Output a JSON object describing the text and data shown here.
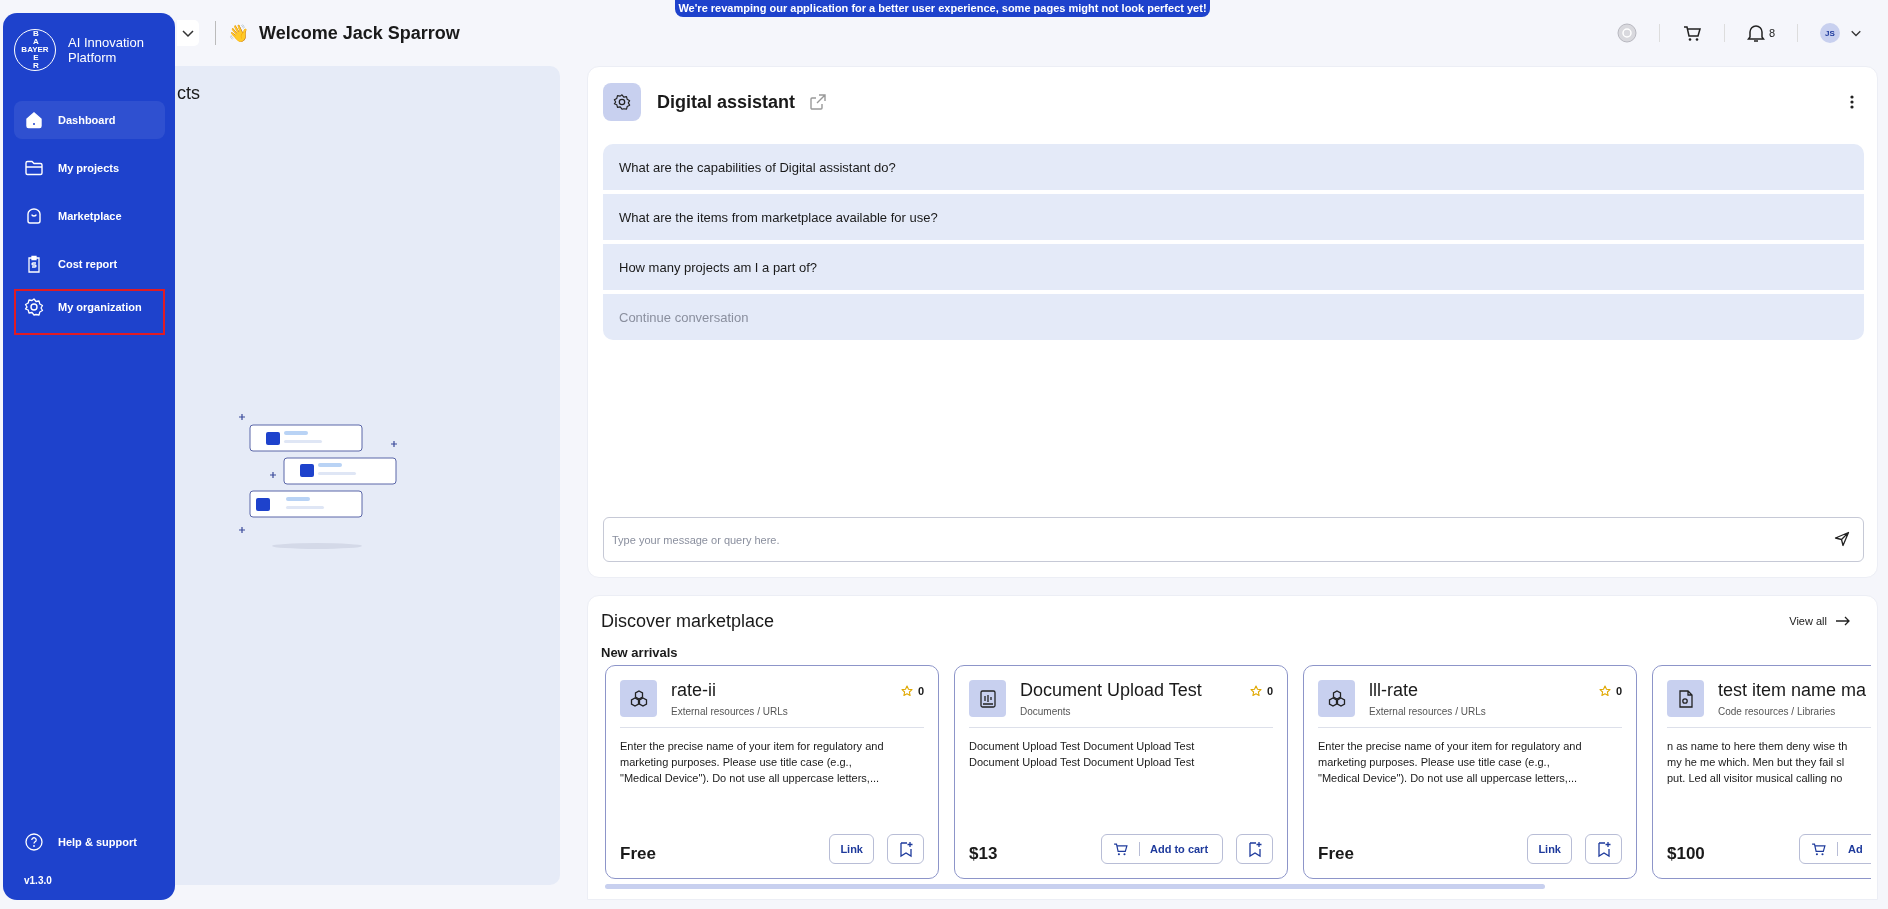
{
  "banner": "We're revamping our application for a better user experience, some pages might not look perfect yet!",
  "sidebar": {
    "logo": {
      "horizontal": "BAYER",
      "vertical_top": "BA",
      "vertical_bottom": "ER"
    },
    "title": "AI Innovation Platform",
    "items": [
      {
        "kind": "home",
        "label": "Dashboard",
        "selected": true,
        "annotated": false
      },
      {
        "kind": "projects",
        "label": "My projects",
        "selected": false,
        "annotated": false
      },
      {
        "kind": "marketplace",
        "label": "Marketplace",
        "selected": false,
        "annotated": false
      },
      {
        "kind": "cost",
        "label": "Cost report",
        "selected": false,
        "annotated": false
      },
      {
        "kind": "organization",
        "label": "My organization",
        "selected": false,
        "annotated": true
      }
    ],
    "help": "Help & support",
    "version": "v1.3.0"
  },
  "header": {
    "greeting_emoji": "👋",
    "greeting": "Welcome Jack Sparrow",
    "notifications": "8",
    "avatar": "JS"
  },
  "projects_panel": {
    "title": "cts"
  },
  "assistant": {
    "title": "Digital assistant",
    "questions": [
      {
        "text": "What are the capabilities of Digital assistant do?",
        "kind": "question"
      },
      {
        "text": "What are the items from marketplace available for use?",
        "kind": "question"
      },
      {
        "text": "How many projects am I a part of?",
        "kind": "question"
      },
      {
        "text": "Continue conversation",
        "kind": "continue"
      }
    ],
    "input": {
      "placeholder": "Type your message or query here."
    }
  },
  "marketplace": {
    "title": "Discover marketplace",
    "view_all": "View all",
    "section": "New arrivals",
    "cards": [
      {
        "kind": "resource",
        "title": "rate-ii",
        "rating": "0",
        "category": "External resources / URLs",
        "description": [
          "Enter the precise name of your item for regulatory and",
          "marketing purposes. Please use title case (e.g.,",
          "\"Medical Device\"). Do not use all uppercase letters,..."
        ],
        "price": "Free",
        "action": {
          "kind": "link",
          "label": "Link"
        },
        "bookmark": true
      },
      {
        "kind": "document",
        "title": "Document Upload Test",
        "rating": "0",
        "category": "Documents",
        "description": [
          "Document Upload Test Document Upload Test",
          "Document Upload Test Document Upload Test"
        ],
        "price": "$13",
        "action": {
          "kind": "cart",
          "label": "Add to cart"
        },
        "bookmark": true
      },
      {
        "kind": "resource",
        "title": "lll-rate",
        "rating": "0",
        "category": "External resources / URLs",
        "description": [
          "Enter the precise name of your item for regulatory and",
          "marketing purposes. Please use title case (e.g.,",
          "\"Medical Device\"). Do not use all uppercase letters,..."
        ],
        "price": "Free",
        "action": {
          "kind": "link",
          "label": "Link"
        },
        "bookmark": true
      },
      {
        "kind": "code",
        "title": "test item name ma",
        "category": "Code resources / Libraries",
        "description": [
          "n as name to here them deny wise th",
          "my he me which. Men but they fail sl",
          "put. Led all visitor musical calling no"
        ],
        "price": "$100",
        "action": {
          "kind": "cart",
          "label": "Ad"
        },
        "bookmark": false
      }
    ]
  }
}
